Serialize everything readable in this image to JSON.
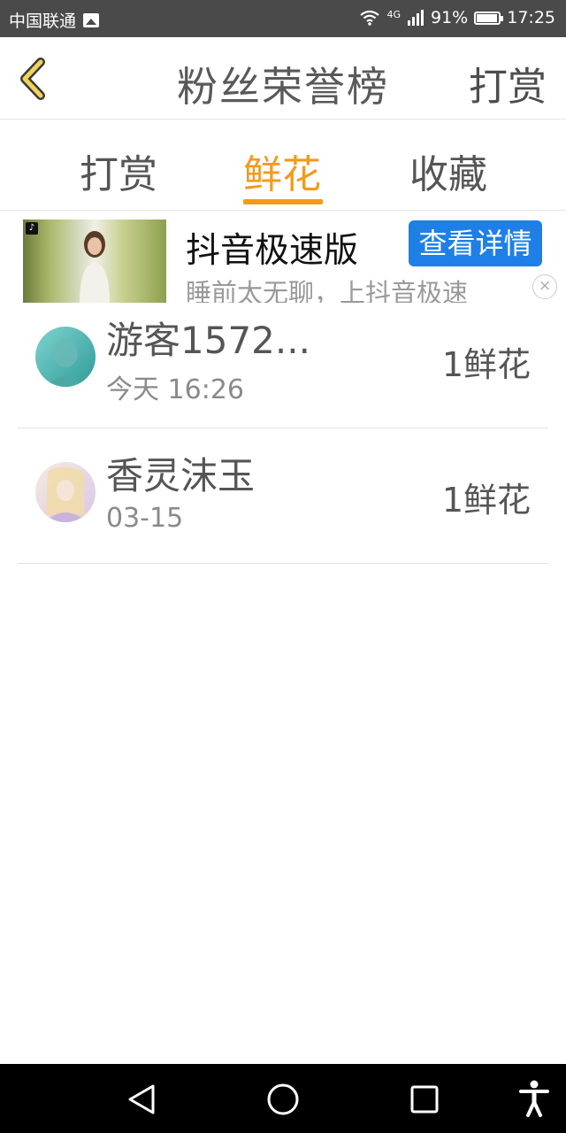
{
  "status_bar": {
    "carrier": "中国联通",
    "network": "4G",
    "battery": "91%",
    "time": "17:25"
  },
  "header": {
    "title": "粉丝荣誉榜",
    "right_action": "打赏"
  },
  "tabs": [
    {
      "label": "打赏",
      "active": false
    },
    {
      "label": "鲜花",
      "active": true
    },
    {
      "label": "收藏",
      "active": false
    }
  ],
  "ad": {
    "title": "抖音极速版",
    "description": "睡前太无聊，上抖音极速",
    "button": "查看详情"
  },
  "list": [
    {
      "name": "游客1572...",
      "time": "今天 16:26",
      "value": "1鲜花"
    },
    {
      "name": "香灵沫玉",
      "time": "03-15",
      "value": "1鲜花"
    }
  ],
  "colors": {
    "accent": "#f39a1d",
    "ad_button": "#1e80e6",
    "status_bar": "#4a4a4a"
  }
}
